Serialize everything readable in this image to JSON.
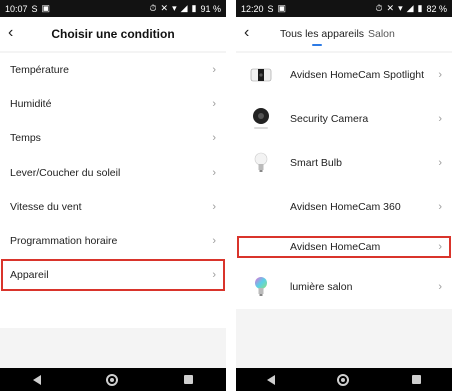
{
  "left": {
    "status": {
      "time": "10:07",
      "battery": "91 %"
    },
    "title": "Choisir une condition",
    "items": [
      {
        "label": "Température"
      },
      {
        "label": "Humidité"
      },
      {
        "label": "Temps"
      },
      {
        "label": "Lever/Coucher du soleil"
      },
      {
        "label": "Vitesse du vent"
      },
      {
        "label": "Programmation horaire"
      },
      {
        "label": "Appareil"
      }
    ]
  },
  "right": {
    "status": {
      "time": "12:20",
      "battery": "82 %"
    },
    "tabs": {
      "all": "Tous les appareils",
      "salon": "Salon"
    },
    "devices": [
      {
        "label": "Avidsen HomeCam Spotlight",
        "icon": "spotlight-camera-icon"
      },
      {
        "label": "Security Camera",
        "icon": "security-camera-icon"
      },
      {
        "label": "Smart Bulb",
        "icon": "bulb-icon"
      },
      {
        "label": "Avidsen HomeCam 360",
        "icon": "none"
      },
      {
        "label": "Avidsen HomeCam",
        "icon": "none"
      },
      {
        "label": "lumière salon",
        "icon": "color-bulb-icon"
      }
    ]
  },
  "colors": {
    "highlight": "#d9342b",
    "accent": "#2d7be5"
  }
}
